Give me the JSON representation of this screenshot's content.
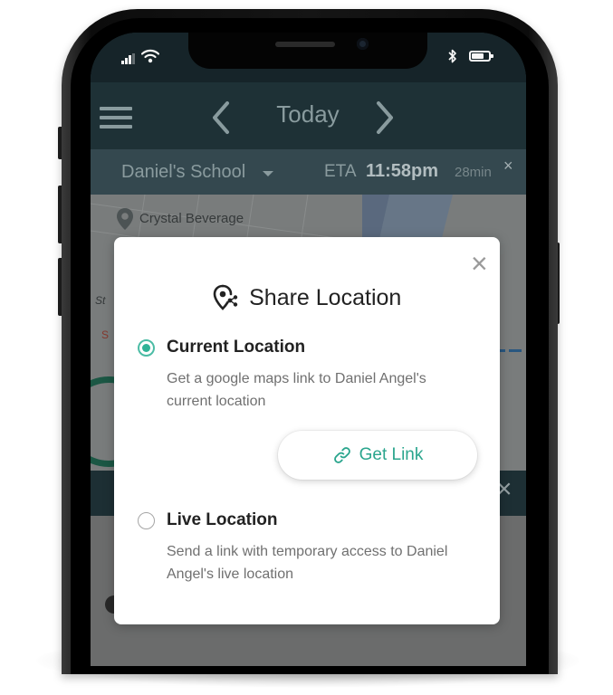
{
  "header": {
    "title": "Today"
  },
  "route": {
    "destination": "Daniel's School",
    "eta_label": "ETA",
    "eta_time": "11:58pm",
    "eta_minutes": "28min",
    "close_glyph": "×"
  },
  "map": {
    "place_label": "Crystal Beverage",
    "street_fragment": "St",
    "street_fragment_2": "S"
  },
  "modal": {
    "title": "Share Location",
    "close_glyph": "×",
    "options": [
      {
        "label": "Current Location",
        "description": "Get a google maps link to Daniel Angel's current location",
        "selected": true
      },
      {
        "label": "Live Location",
        "description": "Send a link with temporary access to Daniel Angel's live location",
        "selected": false
      }
    ],
    "get_link_label": "Get Link"
  },
  "panel": {
    "close_glyph": "×"
  },
  "colors": {
    "accent": "#2fb397",
    "link_text": "#2aa58d",
    "header_bg": "#1f3338",
    "route_bar_bg": "#364b52"
  },
  "icons": {
    "menu": "hamburger-icon",
    "prev": "chevron-left-icon",
    "next": "chevron-right-icon",
    "dropdown": "caret-down-icon",
    "share": "share-location-pin-icon",
    "link": "link-icon",
    "place": "map-pin-icon"
  }
}
